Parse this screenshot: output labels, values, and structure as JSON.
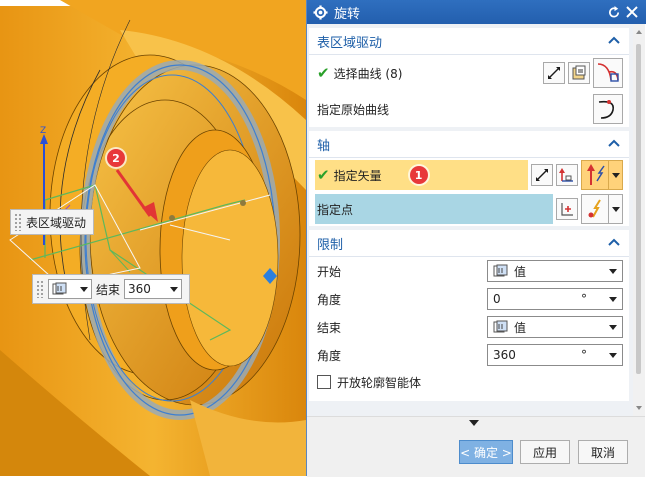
{
  "viewport": {
    "axis_label": "Z",
    "floating_label": "表区域驱动",
    "bar": {
      "field_label": "结束",
      "value": "360"
    },
    "badge_2": "2"
  },
  "dialog": {
    "title": "旋转",
    "groups": {
      "surface": {
        "title": "表区域驱动",
        "select_curve": "选择曲线 (8)",
        "original_curve": "指定原始曲线"
      },
      "axis": {
        "title": "轴",
        "vector": "指定矢量",
        "badge_1": "1",
        "point": "指定点"
      },
      "limit": {
        "title": "限制",
        "start_label": "开始",
        "start_value": "值",
        "angle1_label": "角度",
        "angle1_value": "0",
        "end_label": "结束",
        "end_value": "值",
        "angle2_label": "角度",
        "angle2_value": "360",
        "unit": "°",
        "open_profile": "开放轮廓智能体"
      }
    },
    "buttons": {
      "ok": "< 确定 >",
      "apply": "应用",
      "cancel": "取消"
    }
  },
  "colors": {
    "accent": "#2f6fbf",
    "highlight_yellow": "#ffdf86",
    "highlight_blue": "#a9d6e4",
    "badge": "#e8383a",
    "part_orange": "#f2a81e"
  }
}
